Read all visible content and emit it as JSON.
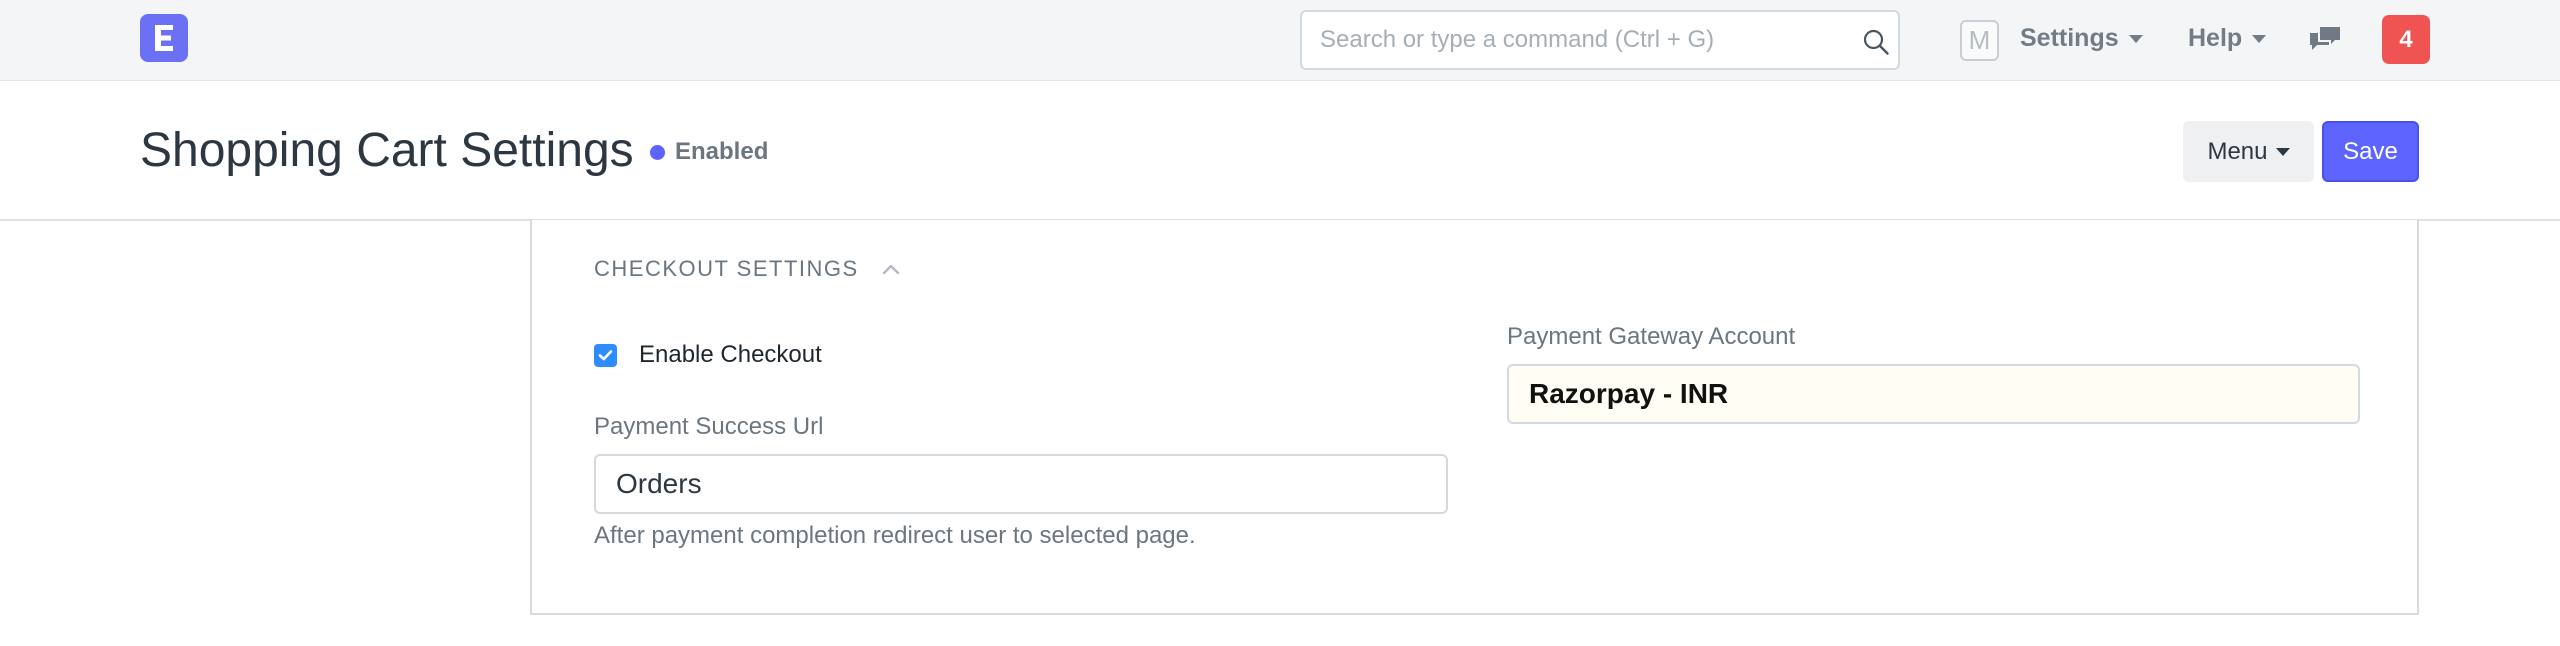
{
  "navbar": {
    "logo_letter": "E",
    "search": {
      "placeholder": "Search or type a command (Ctrl + G)",
      "value": ""
    },
    "avatar_letter": "M",
    "settings_label": "Settings",
    "help_label": "Help",
    "notification_count": "4"
  },
  "page": {
    "title": "Shopping Cart Settings",
    "status": "Enabled",
    "menu_label": "Menu",
    "save_label": "Save"
  },
  "section": {
    "title": "CHECKOUT SETTINGS",
    "enable_checkout": {
      "label": "Enable Checkout",
      "checked": true
    },
    "payment_success_url": {
      "label": "Payment Success Url",
      "value": "Orders",
      "help": "After payment completion redirect user to selected page."
    },
    "payment_gateway_account": {
      "label": "Payment Gateway Account",
      "value": "Razorpay - INR"
    }
  },
  "colors": {
    "primary": "#5e64ff",
    "logo": "#6c70f5",
    "notification": "#f05452",
    "checkbox": "#2d8cff"
  },
  "icons": [
    "logo-icon",
    "search-icon",
    "caret-down-icon",
    "chat-icon",
    "chevron-up-icon",
    "check-icon"
  ]
}
